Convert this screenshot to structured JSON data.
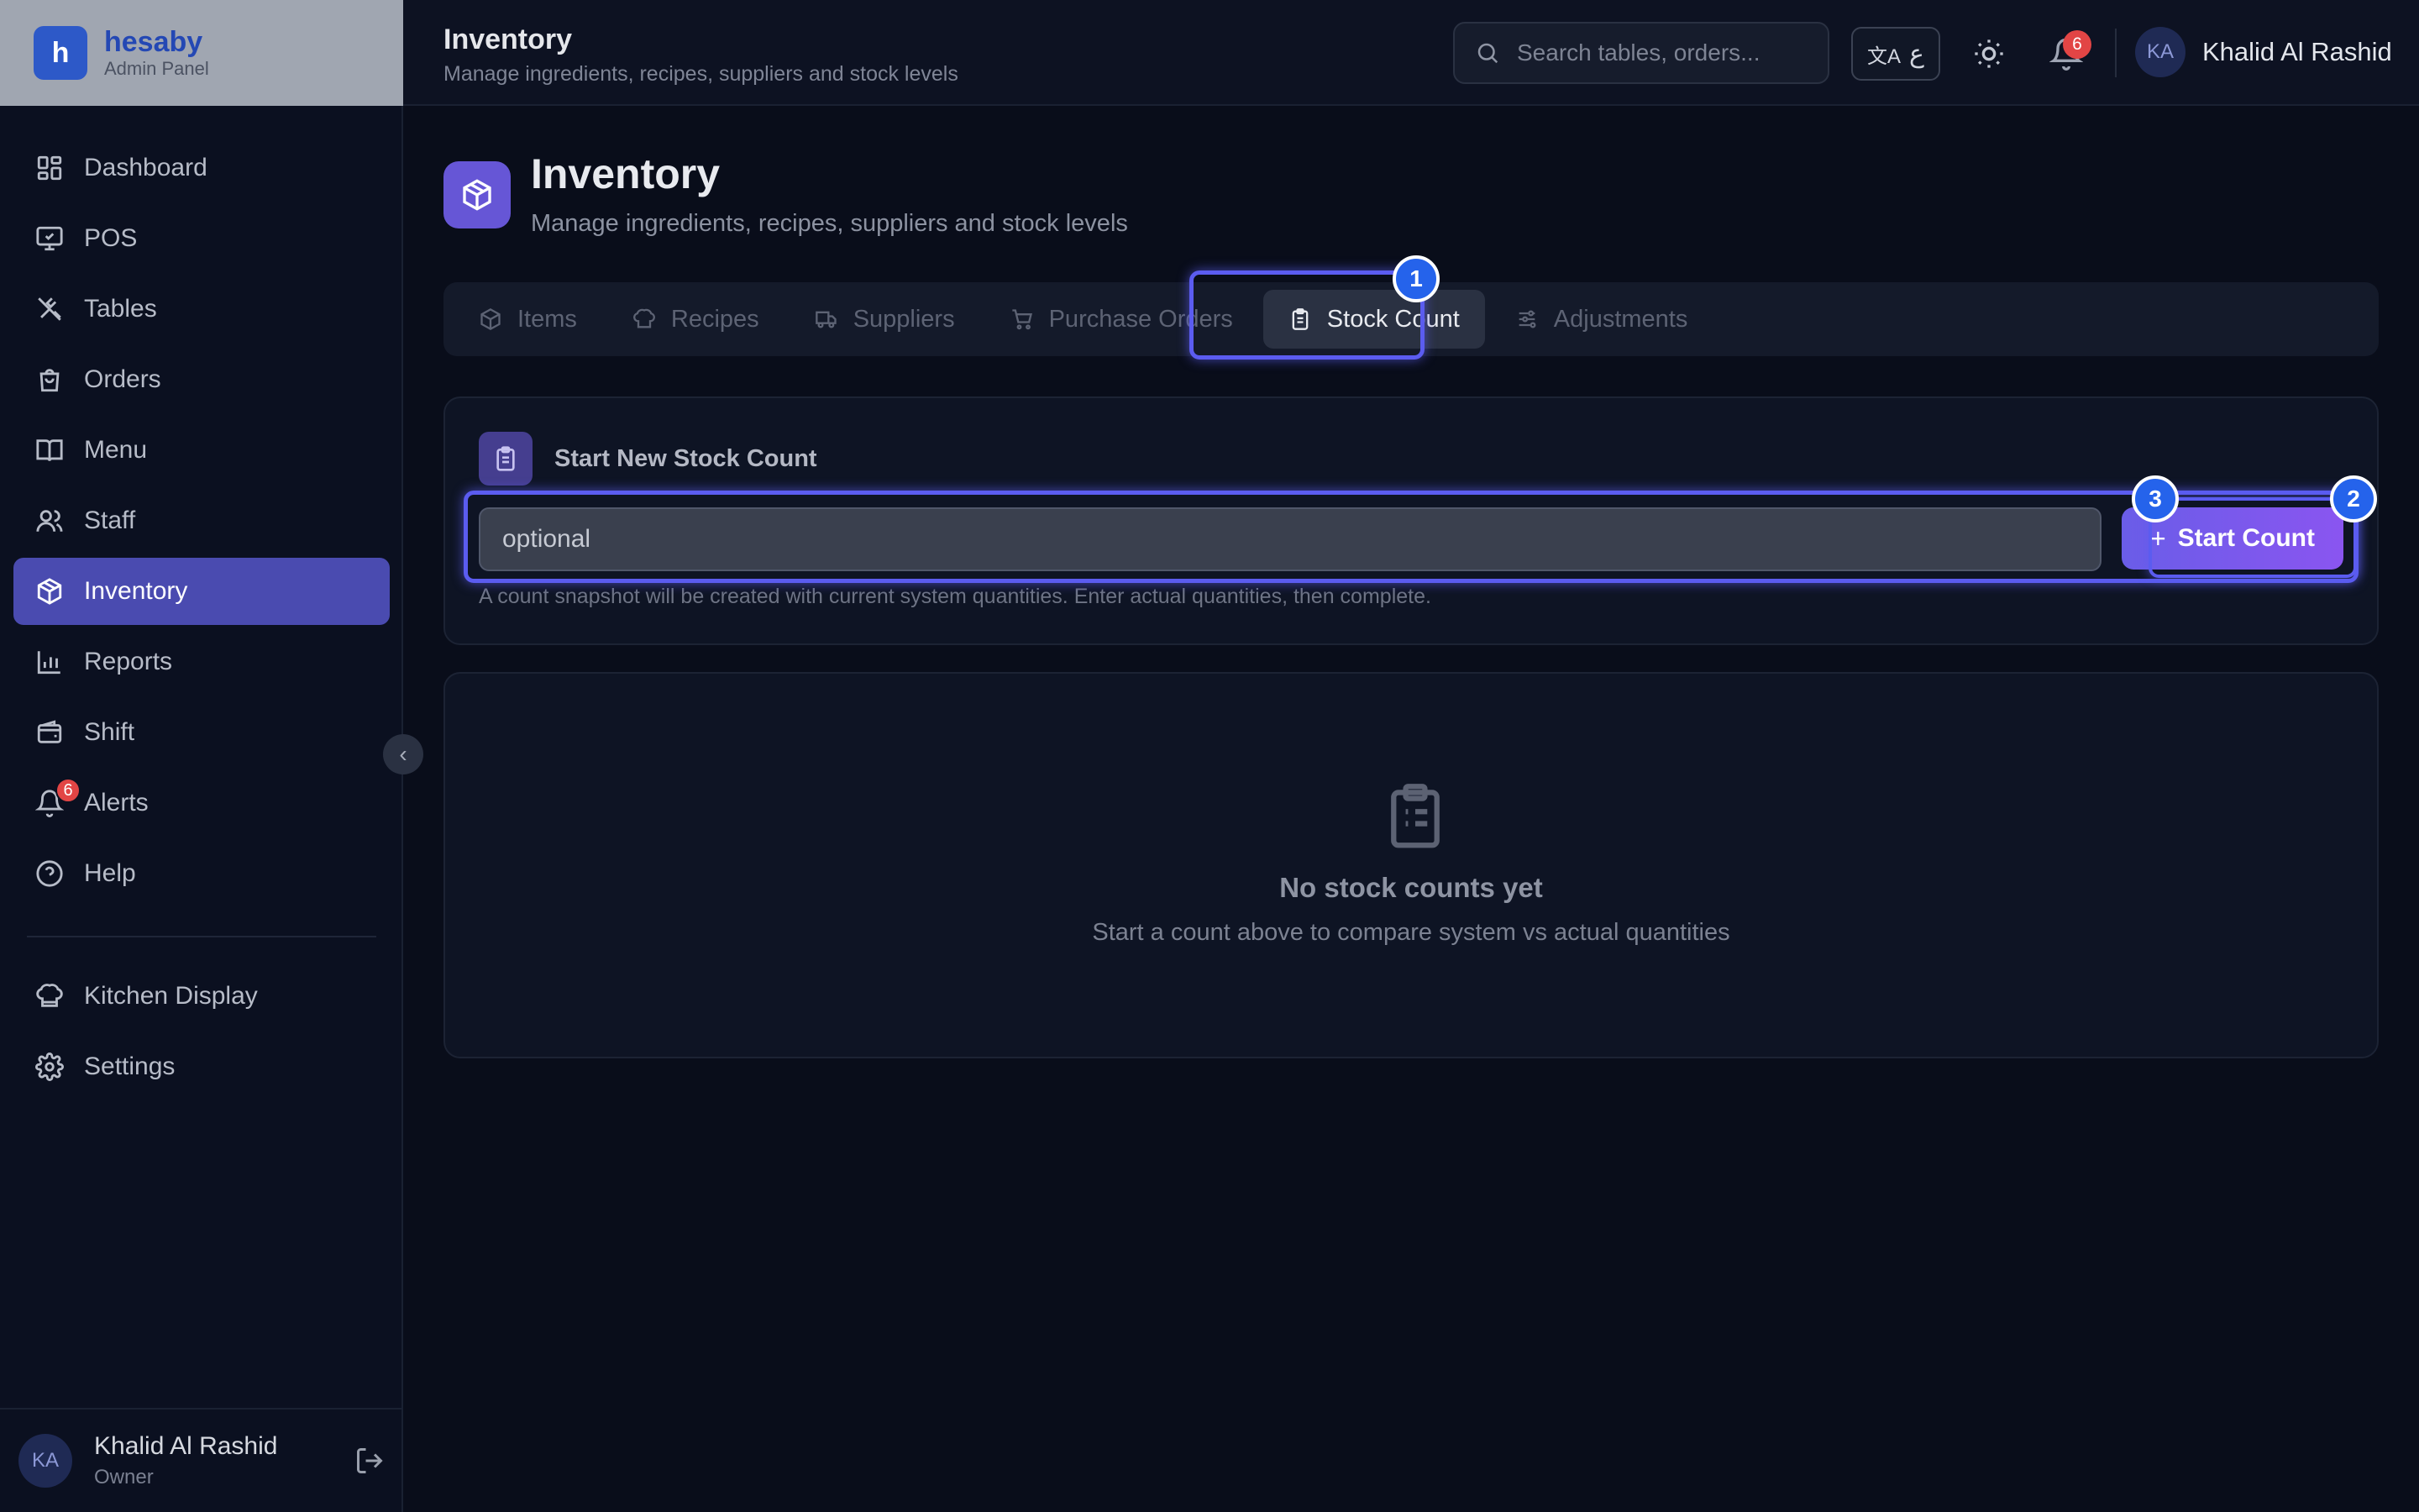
{
  "brand": {
    "logo_letter": "h",
    "name": "hesaby",
    "subtitle": "Admin Panel"
  },
  "header": {
    "title": "Inventory",
    "subtitle": "Manage ingredients, recipes, suppliers and stock levels",
    "search_placeholder": "Search tables, orders...",
    "lang_label": "ع",
    "notification_count": "6",
    "user_initials": "KA",
    "user_name": "Khalid Al Rashid"
  },
  "sidebar": {
    "items": [
      {
        "label": "Dashboard",
        "icon": "grid-icon"
      },
      {
        "label": "POS",
        "icon": "monitor-icon"
      },
      {
        "label": "Tables",
        "icon": "utensils-icon"
      },
      {
        "label": "Orders",
        "icon": "bag-icon"
      },
      {
        "label": "Menu",
        "icon": "book-icon"
      },
      {
        "label": "Staff",
        "icon": "users-icon"
      },
      {
        "label": "Inventory",
        "icon": "box-icon",
        "active": true
      },
      {
        "label": "Reports",
        "icon": "bar-chart-icon"
      },
      {
        "label": "Shift",
        "icon": "wallet-icon"
      },
      {
        "label": "Alerts",
        "icon": "bell-icon",
        "badge": "6"
      },
      {
        "label": "Help",
        "icon": "help-icon"
      }
    ],
    "bottom_items": [
      {
        "label": "Kitchen Display",
        "icon": "chef-hat-icon"
      },
      {
        "label": "Settings",
        "icon": "gear-icon"
      }
    ],
    "collapse_glyph": "‹",
    "footer": {
      "initials": "KA",
      "name": "Khalid Al Rashid",
      "role": "Owner"
    }
  },
  "page": {
    "title": "Inventory",
    "subtitle": "Manage ingredients, recipes, suppliers and stock levels"
  },
  "tabs": [
    {
      "label": "Items",
      "icon": "box-icon"
    },
    {
      "label": "Recipes",
      "icon": "chef-hat-icon"
    },
    {
      "label": "Suppliers",
      "icon": "truck-icon"
    },
    {
      "label": "Purchase Orders",
      "icon": "cart-icon"
    },
    {
      "label": "Stock Count",
      "icon": "clipboard-icon",
      "active": true
    },
    {
      "label": "Adjustments",
      "icon": "sliders-icon"
    }
  ],
  "stock_count": {
    "title": "Start New Stock Count",
    "input_value": "optional",
    "button_label": "Start Count",
    "button_glyph": "+",
    "hint": "A count snapshot will be created with current system quantities. Enter actual quantities, then complete."
  },
  "empty_state": {
    "title": "No stock counts yet",
    "subtitle": "Start a count above to compare system vs actual quantities"
  },
  "annotations": [
    "1",
    "2",
    "3"
  ],
  "colors": {
    "accent": "#4a4bb0",
    "button_gradient_start": "#6a5de8",
    "button_gradient_end": "#8a55f0",
    "badge": "#e24545",
    "marker": "#2563eb"
  }
}
